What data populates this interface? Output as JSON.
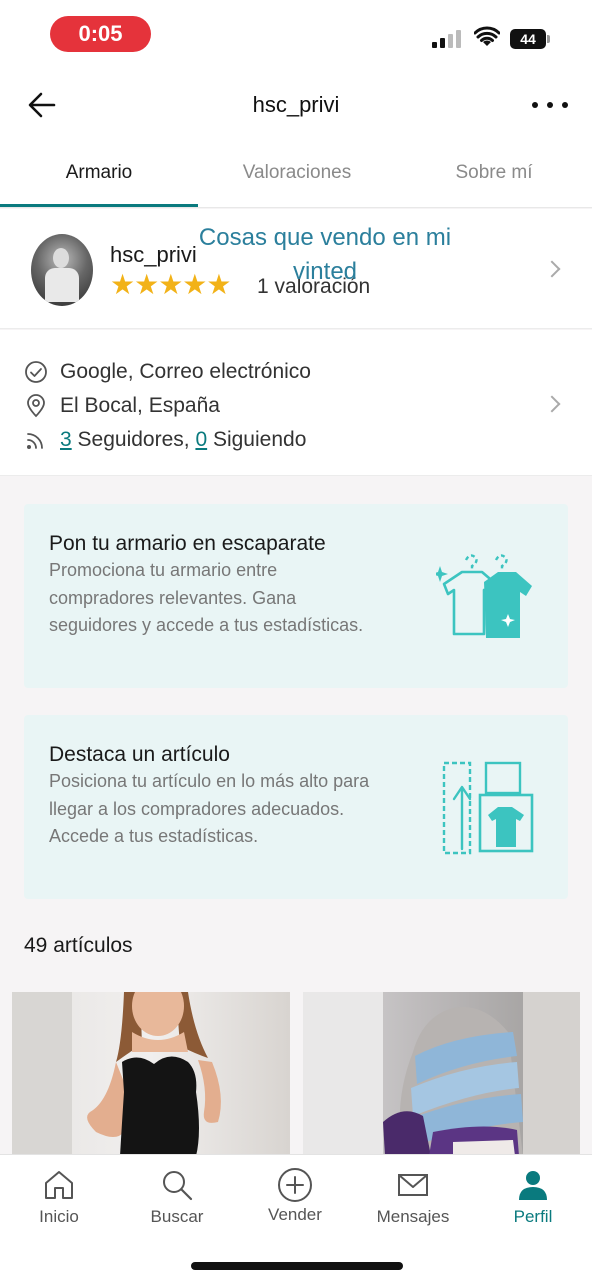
{
  "status_bar": {
    "time": "0:05",
    "battery": "44"
  },
  "header": {
    "title": "hsc_privi"
  },
  "tabs": [
    {
      "label": "Armario"
    },
    {
      "label": "Valoraciones"
    },
    {
      "label": "Sobre mí"
    }
  ],
  "profile": {
    "username": "hsc_privi",
    "stars": "★★★★★",
    "rating_count": "1 valoración",
    "overlay_caption": "Cosas que vendo en mi vinted"
  },
  "info": {
    "verified": "Google, Correo electrónico",
    "location": "El Bocal, España",
    "followers_count": "3",
    "followers_label": " Seguidores, ",
    "following_count": "0",
    "following_label": " Siguiendo"
  },
  "promo_wardrobe": {
    "title": "Pon tu armario en escaparate",
    "description": "Promociona tu armario entre compradores relevantes. Gana seguidores y accede a tus estadísticas."
  },
  "promo_item": {
    "title": "Destaca un artículo",
    "description": "Posiciona tu artículo en lo más alto para llegar a los compradores adecuados. Accede a tus estadísticas."
  },
  "items_count": "49 artículos",
  "bottom_nav": [
    {
      "label": "Inicio",
      "icon": "home-icon"
    },
    {
      "label": "Buscar",
      "icon": "search-icon"
    },
    {
      "label": "Vender",
      "icon": "plus-circle-icon"
    },
    {
      "label": "Mensajes",
      "icon": "mail-icon"
    },
    {
      "label": "Perfil",
      "icon": "person-icon"
    }
  ],
  "colors": {
    "accent": "#0a7a7e",
    "promo_bg": "#e9f5f5",
    "promo_art": "#3cc4c0",
    "star": "#f2b218",
    "time_pill": "#e5333b"
  }
}
